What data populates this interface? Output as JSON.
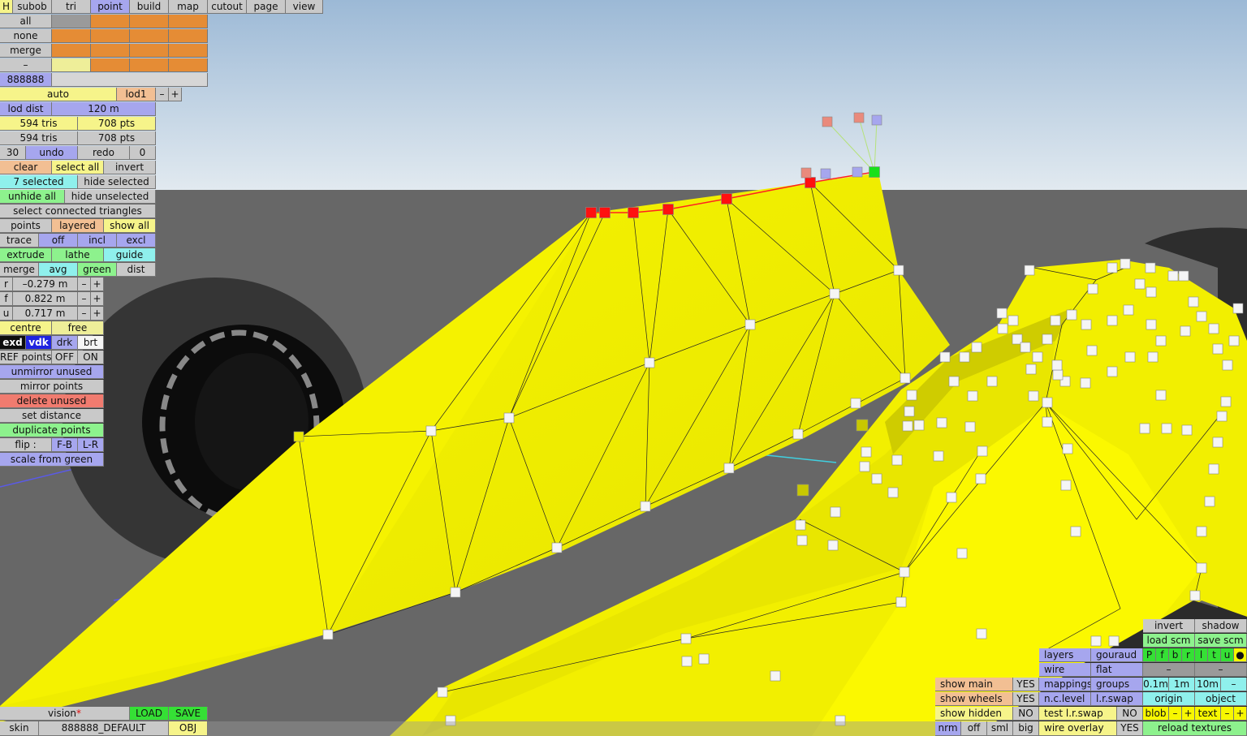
{
  "menu": {
    "h": "H",
    "tabs": [
      "subob",
      "tri",
      "point",
      "build",
      "map",
      "cutout",
      "page",
      "view"
    ],
    "active": "point"
  },
  "sel": {
    "rows": [
      "all",
      "none",
      "merge",
      "–"
    ],
    "color_code": "888888"
  },
  "lod": {
    "auto": "auto",
    "lod1": "lod1",
    "minus": "–",
    "plus": "+",
    "dist_label": "lod dist",
    "dist_value": "120 m"
  },
  "counts": {
    "tris1": "594 tris",
    "pts1": "708 pts",
    "tris2": "594 tris",
    "pts2": "708 pts"
  },
  "undo": {
    "steps": "30",
    "undo": "undo",
    "redo": "redo",
    "zero": "0"
  },
  "select": {
    "clear": "clear",
    "select_all": "select all",
    "invert": "invert",
    "selected": "7 selected",
    "hide_selected": "hide selected",
    "unhide_all": "unhide all",
    "hide_unselected": "hide unselected",
    "connected": "select connected triangles"
  },
  "mode": {
    "points": "points",
    "layered": "layered",
    "show_all": "show all",
    "trace": "trace",
    "off": "off",
    "incl": "incl",
    "excl": "excl",
    "extrude": "extrude",
    "lathe": "lathe",
    "guide": "guide",
    "merge": "merge",
    "avg": "avg",
    "green": "green",
    "dist": "dist"
  },
  "coords": {
    "r_label": "r",
    "r_value": "–0.279 m",
    "f_label": "f",
    "f_value": "0.822 m",
    "u_label": "u",
    "u_value": "0.717 m",
    "minus": "–",
    "plus": "+"
  },
  "pivot": {
    "centre": "centre",
    "free": "free"
  },
  "shade": {
    "exd": "exd",
    "vdk": "vdk",
    "drk": "drk",
    "brt": "brt"
  },
  "ref": {
    "label": "REF points",
    "off": "OFF",
    "on": "ON"
  },
  "ops": {
    "unmirror": "unmirror unused",
    "mirror": "mirror points",
    "delete": "delete unused",
    "set_distance": "set distance",
    "duplicate": "duplicate points",
    "flip": "flip :",
    "fb": "F-B",
    "lr": "L-R",
    "scale": "scale from green"
  },
  "bottom_left": {
    "vision": "vision",
    "star": "*",
    "load": "LOAD",
    "save": "SAVE",
    "skin": "skin",
    "skin_value": "888888_DEFAULT",
    "obj": "OBJ"
  },
  "right_panel": {
    "invert": "invert",
    "shadow": "shadow",
    "load_scm": "load scm",
    "save_scm": "save scm",
    "layers": "layers",
    "gouraud": "gouraud",
    "wire": "wire",
    "flat": "flat",
    "layer_buttons": [
      "P",
      "f",
      "b",
      "r",
      "l",
      "t",
      "u",
      "●"
    ],
    "dash": "–",
    "show_main": "show main",
    "show_main_val": "YES",
    "mappings": "mappings",
    "groups": "groups",
    "grid": [
      "0.1m",
      "1m",
      "10m",
      "–"
    ],
    "show_wheels": "show wheels",
    "show_wheels_val": "YES",
    "nc_level": "n.c.level",
    "lr_swap": "l.r.swap",
    "origin": "origin",
    "object": "object",
    "show_hidden": "show hidden",
    "show_hidden_val": "NO",
    "test_lr_swap": "test l.r.swap",
    "test_lr_val": "NO",
    "blob": "blob",
    "text": "text",
    "minus": "–",
    "plus": "+",
    "nrm": "nrm",
    "off": "off",
    "sml": "sml",
    "big": "big",
    "wire_overlay": "wire overlay",
    "wire_overlay_val": "YES",
    "reload": "reload textures"
  },
  "colors": {
    "sky_top": "#9fbbd6",
    "sky_bottom": "#dfe8ef",
    "ground": "#666666",
    "body": "#f2f000",
    "selected_point": "#ff1010",
    "green_point": "#19e019"
  }
}
